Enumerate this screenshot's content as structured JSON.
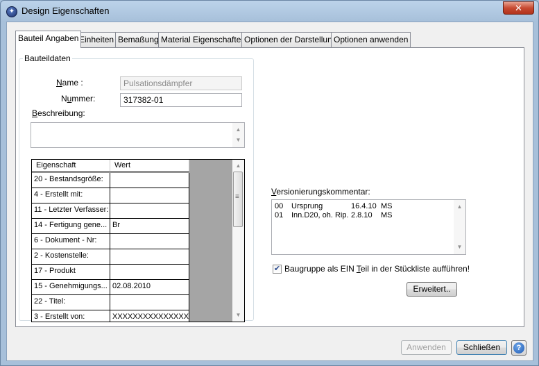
{
  "window": {
    "title": "Design Eigenschaften",
    "close_glyph": "✕",
    "icon": "app-logo-icon"
  },
  "tabs": [
    {
      "label": "Bauteil Angaben",
      "active": true
    },
    {
      "label": "Einheiten"
    },
    {
      "label": "Bemaßung"
    },
    {
      "label": "Material Eigenschaften"
    },
    {
      "label": "Optionen der Darstellung"
    },
    {
      "label": "Optionen anwenden"
    }
  ],
  "group": {
    "title": "Bauteildaten"
  },
  "form": {
    "name_label_pre": "",
    "name_label_ul": "N",
    "name_label_post": "ame :",
    "name_value": "Pulsationsdämpfer",
    "number_label_pre": "N",
    "number_label_ul": "u",
    "number_label_post": "mmer:",
    "number_value": "317382-01",
    "desc_label_ul": "B",
    "desc_label_post": "eschreibung:",
    "desc_value": ""
  },
  "grid": {
    "headers": [
      "Eigenschaft",
      "Wert"
    ],
    "rows": [
      {
        "name": "20 - Bestandsgröße:",
        "value": ""
      },
      {
        "name": "4 - Erstellt mit:",
        "value": ""
      },
      {
        "name": "11 - Letzter Verfasser:",
        "value": ""
      },
      {
        "name": "14 - Fertigung gene...",
        "value": "Br"
      },
      {
        "name": "6 - Dokument - Nr:",
        "value": ""
      },
      {
        "name": "2 - Kostenstelle:",
        "value": ""
      },
      {
        "name": "17 - Produkt",
        "value": ""
      },
      {
        "name": "15 - Genehmigungs...",
        "value": "02.08.2010"
      },
      {
        "name": "22 - Titel:",
        "value": ""
      },
      {
        "name": "3 - Erstellt von:",
        "value": "XXXXXXXXXXXXXXXXXX"
      }
    ]
  },
  "version": {
    "label_ul": "V",
    "label_post": "ersionierungskommentar:",
    "lines": [
      {
        "num": "00",
        "text": "Ursprung",
        "date": "16.4.10",
        "user": "MS"
      },
      {
        "num": "01",
        "text": "Inn.D20, oh. Rip.",
        "date": "2.8.10",
        "user": "MS"
      }
    ]
  },
  "assembly": {
    "checked": true,
    "label_pre": "Baugruppe als EIN ",
    "label_ul": "T",
    "label_post": "eil in der Stückliste aufführen!"
  },
  "buttons": {
    "advanced": "Erweitert..",
    "apply": "Anwenden",
    "close": "Schließen",
    "help_glyph": "?"
  },
  "scroll_glyphs": {
    "up": "▲",
    "down": "▼",
    "grip": "≡"
  }
}
